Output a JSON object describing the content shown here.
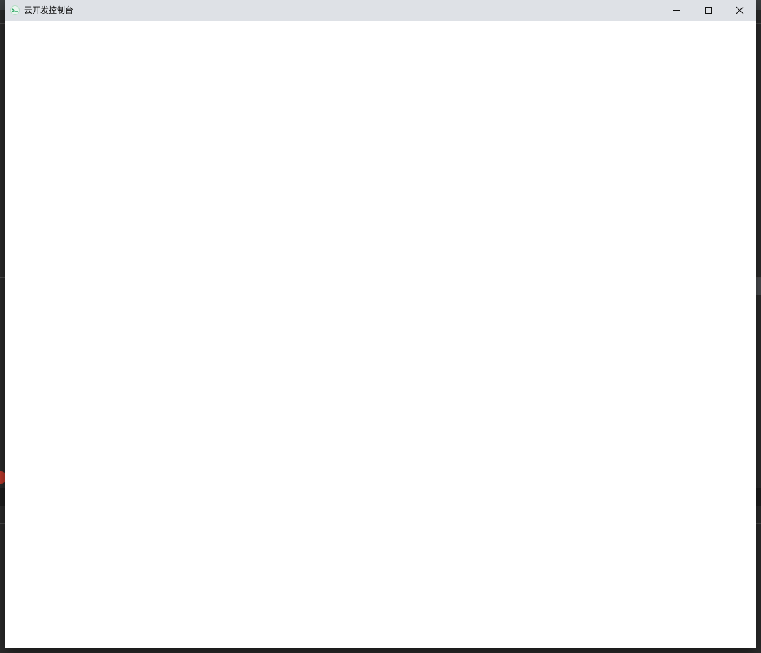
{
  "window": {
    "title": "云开发控制台",
    "icon": "cloudbase-icon",
    "controls": {
      "minimize_icon": "minimize-icon",
      "maximize_icon": "maximize-icon",
      "close_icon": "close-icon"
    }
  },
  "colors": {
    "titlebar_bg": "#dee1e6",
    "content_bg": "#ffffff",
    "desktop_bg": "#2b2b2b",
    "icon_accent": "#2fa866"
  }
}
